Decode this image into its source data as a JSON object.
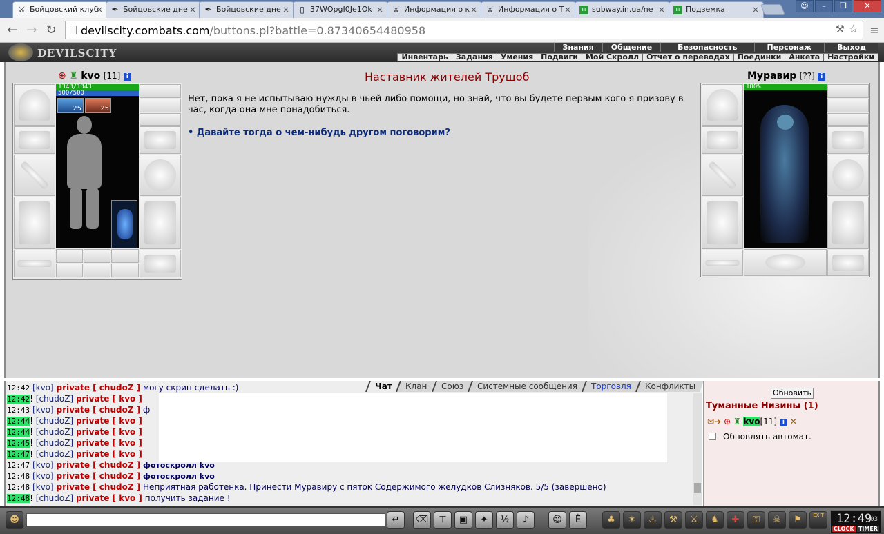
{
  "browser": {
    "tabs": [
      {
        "title": "Бойцовский клуб",
        "icon": "crossed-swords-icon",
        "active": true
      },
      {
        "title": "Бойцовские дне",
        "icon": "quill-icon"
      },
      {
        "title": "Бойцовские дне",
        "icon": "quill-icon"
      },
      {
        "title": "37WOpgI0Je1Ok",
        "icon": "page-icon"
      },
      {
        "title": "Информация о к",
        "icon": "crossed-swords-icon"
      },
      {
        "title": "Информация о Т",
        "icon": "crossed-swords-icon"
      },
      {
        "title": "subway.in.ua/ne",
        "icon": "subway-icon"
      },
      {
        "title": "Подземка",
        "icon": "subway-icon"
      }
    ],
    "url_host": "devilscity.combats.com",
    "url_path": "/buttons.pl?battle=0.87340654480958",
    "close_glyph": "×"
  },
  "game": {
    "logo_text": "DEVILSCITY",
    "menu_top": [
      "Знания",
      "Общение",
      "Безопасность",
      "Персонаж",
      "Выход"
    ],
    "menu_sub": [
      "Инвентарь",
      "Задания",
      "Умения",
      "Подвиги",
      "Мой Скролл",
      "Отчет о переводах",
      "Поединки",
      "Анкета",
      "Настройки"
    ]
  },
  "player": {
    "nick": "kvo",
    "level": "[11]",
    "hp": "1343/1343",
    "mp": "500/500",
    "buff1": "25",
    "buff2": "25"
  },
  "npc": {
    "nick": "Муравир",
    "level": "[??]",
    "hp": "100%"
  },
  "dialog": {
    "title": "Наставник жителей Трущоб",
    "text": "Нет, пока я не испытываю нужды в чьей либо помощи, но знай, что вы будете первым кого я призову в час, когда она мне понадобиться.",
    "option": "• Давайте тогда о чем-нибудь другом поговорим?"
  },
  "chat": {
    "tabs": [
      "Чат",
      "Клан",
      "Союз",
      "Системные сообщения",
      "Торговля",
      "Конфликты"
    ],
    "lines": [
      {
        "time": "12:42",
        "hl": false,
        "pre": "",
        "from": "[kvo]",
        "to": "private [ chudoZ ]",
        "msg": "могу скрин сделать :)",
        "bold": false
      },
      {
        "time": "12:42",
        "hl": true,
        "pre": "!",
        "from": "[chudoZ]",
        "to": "private [ kvo ]",
        "msg": "",
        "bold": false
      },
      {
        "time": "12:43",
        "hl": false,
        "pre": "",
        "from": "[kvo]",
        "to": "private [ chudoZ ]",
        "msg": "ф",
        "bold": false
      },
      {
        "time": "12:44",
        "hl": true,
        "pre": "!",
        "from": "[chudoZ]",
        "to": "private [ kvo ]",
        "msg": "",
        "bold": false
      },
      {
        "time": "12:44",
        "hl": true,
        "pre": "!",
        "from": "[chudoZ]",
        "to": "private [ kvo ]",
        "msg": "",
        "bold": false
      },
      {
        "time": "12:45",
        "hl": true,
        "pre": "!",
        "from": "[chudoZ]",
        "to": "private [ kvo ]",
        "msg": "",
        "bold": false
      },
      {
        "time": "12:47",
        "hl": true,
        "pre": "!",
        "from": "[chudoZ]",
        "to": "private [ kvo ]",
        "msg": "",
        "bold": false
      },
      {
        "time": "12:47",
        "hl": false,
        "pre": "",
        "from": "[kvo]",
        "to": "private [ chudoZ ]",
        "msg": "фотоскролл kvo",
        "bold": true
      },
      {
        "time": "12:48",
        "hl": false,
        "pre": "",
        "from": "[kvo]",
        "to": "private [ chudoZ ]",
        "msg": "фотоскролл kvo",
        "bold": true
      },
      {
        "time": "12:48",
        "hl": false,
        "pre": "",
        "from": "[kvo]",
        "to": "private [ chudoZ ]",
        "msg": "Неприятная работенка. Принести Муравиру с пяток Содержимого желудков Слизняков. 5/5 (завершено)",
        "bold": false
      },
      {
        "time": "12:48",
        "hl": true,
        "pre": "!",
        "from": "[chudoZ]",
        "to": "private [ kvo ]",
        "msg": "получить задание !",
        "bold": false
      }
    ]
  },
  "online": {
    "refresh": "Обновить",
    "location": "Туманные Низины (1)",
    "user_nick": "kvo",
    "user_level": "[11]",
    "auto_refresh": "Обновлять автомат."
  },
  "bottom": {
    "time": "12:49",
    "seconds": "03",
    "clock_label": "CLOCK",
    "timer_label": "TIMER",
    "exit_label": "EXIT"
  },
  "colors": {
    "accent_red": "#8a0000",
    "chat_highlight": "#2ee067",
    "hp_green": "#18a818",
    "mp_blue": "#2a63c8"
  }
}
